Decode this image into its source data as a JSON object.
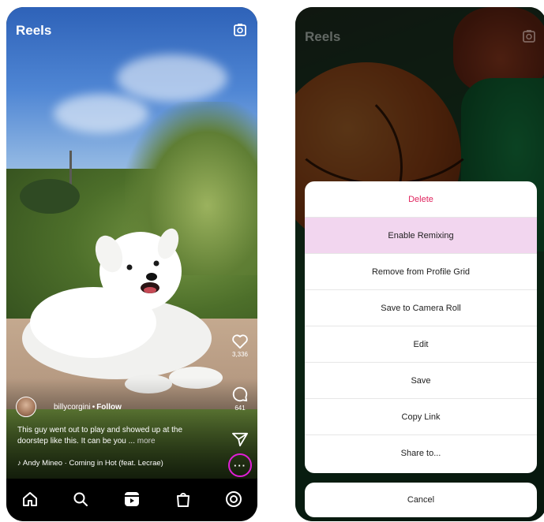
{
  "left": {
    "header": {
      "title": "Reels"
    },
    "post": {
      "username": "billycorgini",
      "separator": "•",
      "follow_label": "Follow",
      "caption": "This guy went out to play and showed up at the doorstep like this. It can be you ...",
      "caption_more": "more",
      "audio": "♪  Andy Mineo · Coming in Hot (feat. Lecrae)"
    },
    "actions": {
      "likes": "3,336",
      "comments": "641"
    },
    "nav": [
      "home-icon",
      "search-icon",
      "reels-icon",
      "shop-icon",
      "profile-icon"
    ],
    "accent_color": "#e01fd6"
  },
  "right": {
    "header": {
      "title": "Reels"
    },
    "sheet": {
      "items": [
        {
          "label": "Delete"
        },
        {
          "label": "Enable Remixing"
        },
        {
          "label": "Remove from Profile Grid"
        },
        {
          "label": "Save to Camera Roll"
        },
        {
          "label": "Edit"
        },
        {
          "label": "Save"
        },
        {
          "label": "Copy Link"
        },
        {
          "label": "Share to..."
        }
      ],
      "cancel_label": "Cancel",
      "danger_color": "#e0245e",
      "highlight_color": "#f2d6ef"
    }
  }
}
